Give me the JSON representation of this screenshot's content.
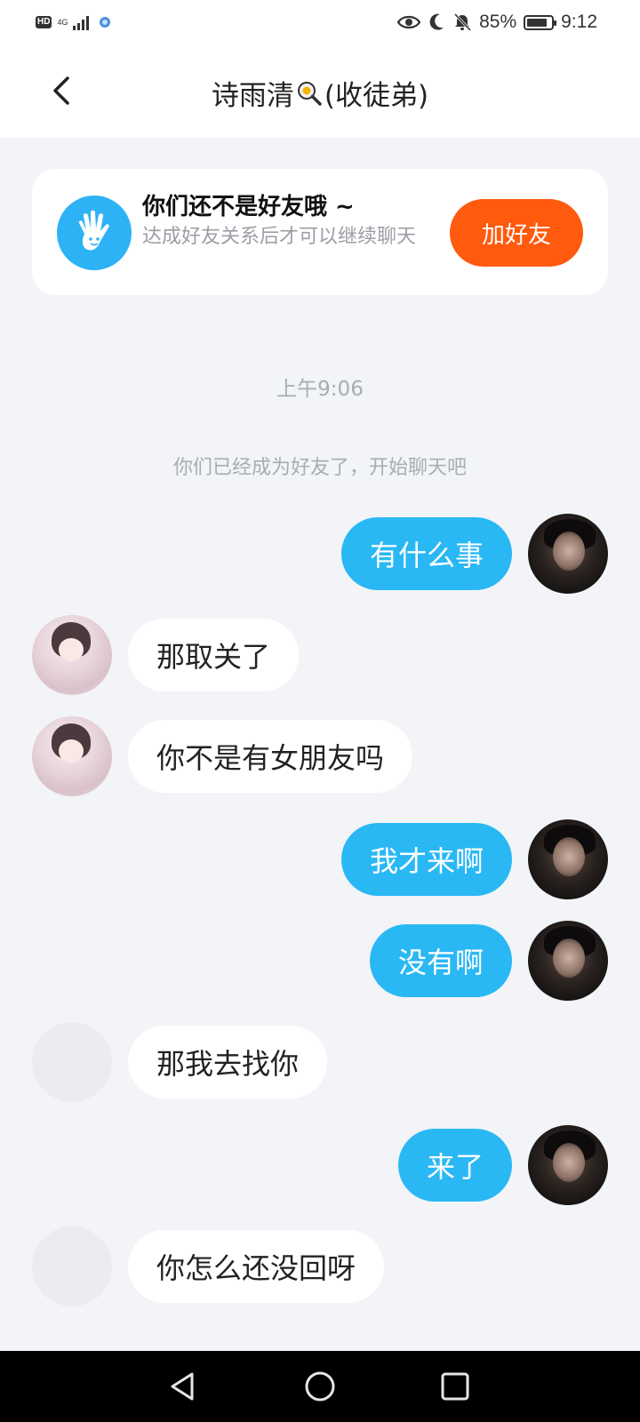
{
  "status_bar": {
    "hd": "HD",
    "network": "4G",
    "battery_text": "85%",
    "battery_level": 0.85,
    "time": "9:12",
    "icons": [
      "eye-icon",
      "moon-icon",
      "bell-off-icon",
      "battery-icon"
    ]
  },
  "header": {
    "title_prefix": "诗雨清",
    "title_suffix": "(收徒弟)",
    "title_emoji": "magnifier-emoji-icon",
    "back_icon": "chevron-left-icon"
  },
  "notice": {
    "title": "你们还不是好友哦 ~",
    "subtitle": "达成好友关系后才可以继续聊天",
    "button": "加好友",
    "icon": "wave-hand-icon",
    "accent": "#ff5a0e"
  },
  "time_label": "上午9:06",
  "system_message": "你们已经成为好友了，开始聊天吧",
  "messages": [
    {
      "dir": "out",
      "text": "有什么事"
    },
    {
      "dir": "in",
      "text": "那取关了"
    },
    {
      "dir": "in",
      "text": "你不是有女朋友吗"
    },
    {
      "dir": "out",
      "text": "我才来啊"
    },
    {
      "dir": "out",
      "text": "没有啊"
    },
    {
      "dir": "in",
      "text": "那我去找你"
    },
    {
      "dir": "out",
      "text": "来了"
    },
    {
      "dir": "in",
      "text": "你怎么还没回呀"
    }
  ],
  "colors": {
    "outgoing_bubble": "#2ab8f5",
    "incoming_bubble": "#ffffff",
    "background": "#f2f4f7"
  },
  "nav": [
    "back-triangle-icon",
    "home-circle-icon",
    "recents-square-icon"
  ]
}
